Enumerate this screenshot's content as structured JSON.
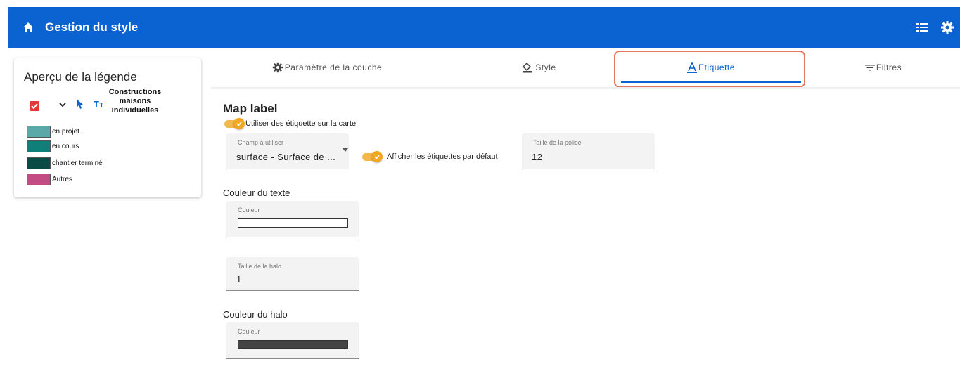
{
  "header": {
    "title": "Gestion du style",
    "bg_color": "#0a63d0",
    "home_icon": "home-icon",
    "list_icon": "list-icon",
    "settings_icon": "gear-icon"
  },
  "legend": {
    "title": "Aperçu de la légende",
    "layer_label": "Constructions maisons individuelles",
    "layer_checked": true,
    "items": [
      {
        "label": "en projet",
        "color": "#5aa8a8"
      },
      {
        "label": "en cours",
        "color": "#0f7f7a"
      },
      {
        "label": "chantier terminé",
        "color": "#0a4a45"
      },
      {
        "label": "Autres",
        "color": "#c54b85"
      }
    ]
  },
  "tabs": [
    {
      "label": "Paramètre de la couche",
      "icon": "gear-icon",
      "active": false
    },
    {
      "label": "Style",
      "icon": "paint-bucket-icon",
      "active": false
    },
    {
      "label": "Etiquette",
      "icon": "text-a-icon",
      "active": true
    },
    {
      "label": "Filtres",
      "icon": "filter-icon",
      "active": false
    }
  ],
  "form": {
    "section_title": "Map label",
    "use_label_toggle": "Utiliser des étiquette sur la carte",
    "field_select": {
      "label": "Champ à utiliser",
      "value": "surface - Surface de ..."
    },
    "show_default_toggle": "Afficher les étiquettes par défaut",
    "font_size": {
      "label": "Taille de la police",
      "value": "12"
    },
    "text_color_title": "Couleur du texte",
    "text_color": {
      "label": "Couleur",
      "value": "#ffffff"
    },
    "halo_size": {
      "label": "Taille de la halo",
      "value": "1"
    },
    "halo_color_title": "Couleur du halo",
    "halo_color": {
      "label": "Couleur",
      "value": "#444444"
    },
    "accent_color": "#f2a823"
  }
}
